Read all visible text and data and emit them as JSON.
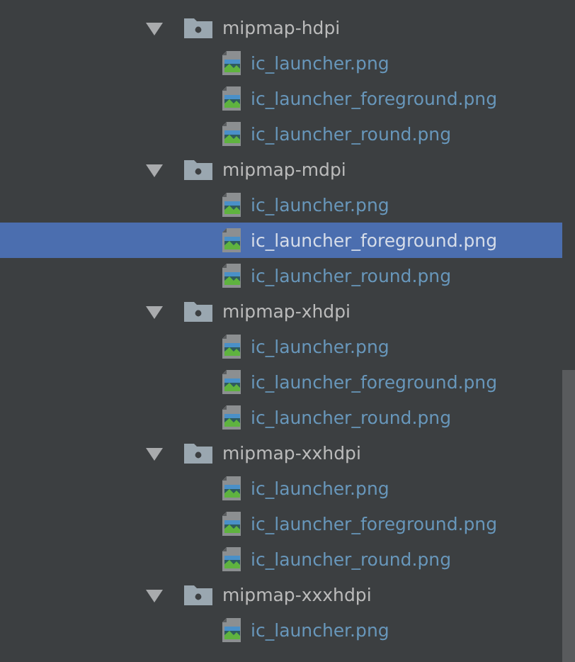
{
  "tree": [
    {
      "name": "mipmap-hdpi",
      "expanded": true,
      "children": [
        {
          "name": "ic_launcher.png",
          "selected": false
        },
        {
          "name": "ic_launcher_foreground.png",
          "selected": false
        },
        {
          "name": "ic_launcher_round.png",
          "selected": false
        }
      ]
    },
    {
      "name": "mipmap-mdpi",
      "expanded": true,
      "children": [
        {
          "name": "ic_launcher.png",
          "selected": false
        },
        {
          "name": "ic_launcher_foreground.png",
          "selected": true
        },
        {
          "name": "ic_launcher_round.png",
          "selected": false
        }
      ]
    },
    {
      "name": "mipmap-xhdpi",
      "expanded": true,
      "children": [
        {
          "name": "ic_launcher.png",
          "selected": false
        },
        {
          "name": "ic_launcher_foreground.png",
          "selected": false
        },
        {
          "name": "ic_launcher_round.png",
          "selected": false
        }
      ]
    },
    {
      "name": "mipmap-xxhdpi",
      "expanded": true,
      "children": [
        {
          "name": "ic_launcher.png",
          "selected": false
        },
        {
          "name": "ic_launcher_foreground.png",
          "selected": false
        },
        {
          "name": "ic_launcher_round.png",
          "selected": false
        }
      ]
    },
    {
      "name": "mipmap-xxxhdpi",
      "expanded": true,
      "children": [
        {
          "name": "ic_launcher.png",
          "selected": false
        }
      ]
    }
  ]
}
